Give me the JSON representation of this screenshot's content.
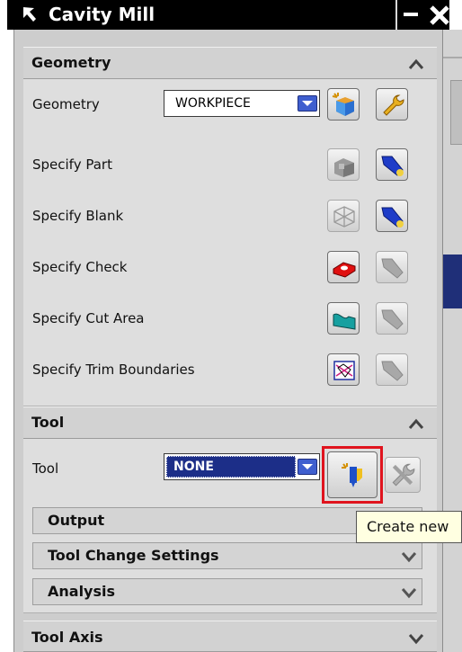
{
  "window": {
    "title": "Cavity Mill"
  },
  "colors": {
    "accent": "#2846c8",
    "highlight": "#e0141e",
    "panel": "#dedede"
  },
  "geometry": {
    "header": "Geometry",
    "rows": [
      {
        "label": "Geometry",
        "value": "WORKPIECE",
        "icons": [
          "create-geometry-icon",
          "edit-wrench-icon"
        ]
      },
      {
        "label": "Specify Part",
        "icons": [
          "part-icon",
          "display-flashlight-icon"
        ]
      },
      {
        "label": "Specify Blank",
        "icons": [
          "blank-icon",
          "display-flashlight-icon"
        ]
      },
      {
        "label": "Specify Check",
        "icons": [
          "check-body-icon",
          "display-flashlight-icon"
        ]
      },
      {
        "label": "Specify Cut Area",
        "icons": [
          "cut-area-icon",
          "display-flashlight-icon"
        ]
      },
      {
        "label": "Specify Trim Boundaries",
        "icons": [
          "trim-boundary-icon",
          "display-flashlight-icon"
        ]
      }
    ]
  },
  "tool": {
    "header": "Tool",
    "label": "Tool",
    "value": "NONE",
    "icons": [
      "create-tool-icon",
      "edit-tool-icon"
    ],
    "subsections": [
      "Output",
      "Tool Change Settings",
      "Analysis"
    ]
  },
  "tool_axis": {
    "header": "Tool Axis"
  },
  "tooltip": {
    "text": "Create new"
  }
}
